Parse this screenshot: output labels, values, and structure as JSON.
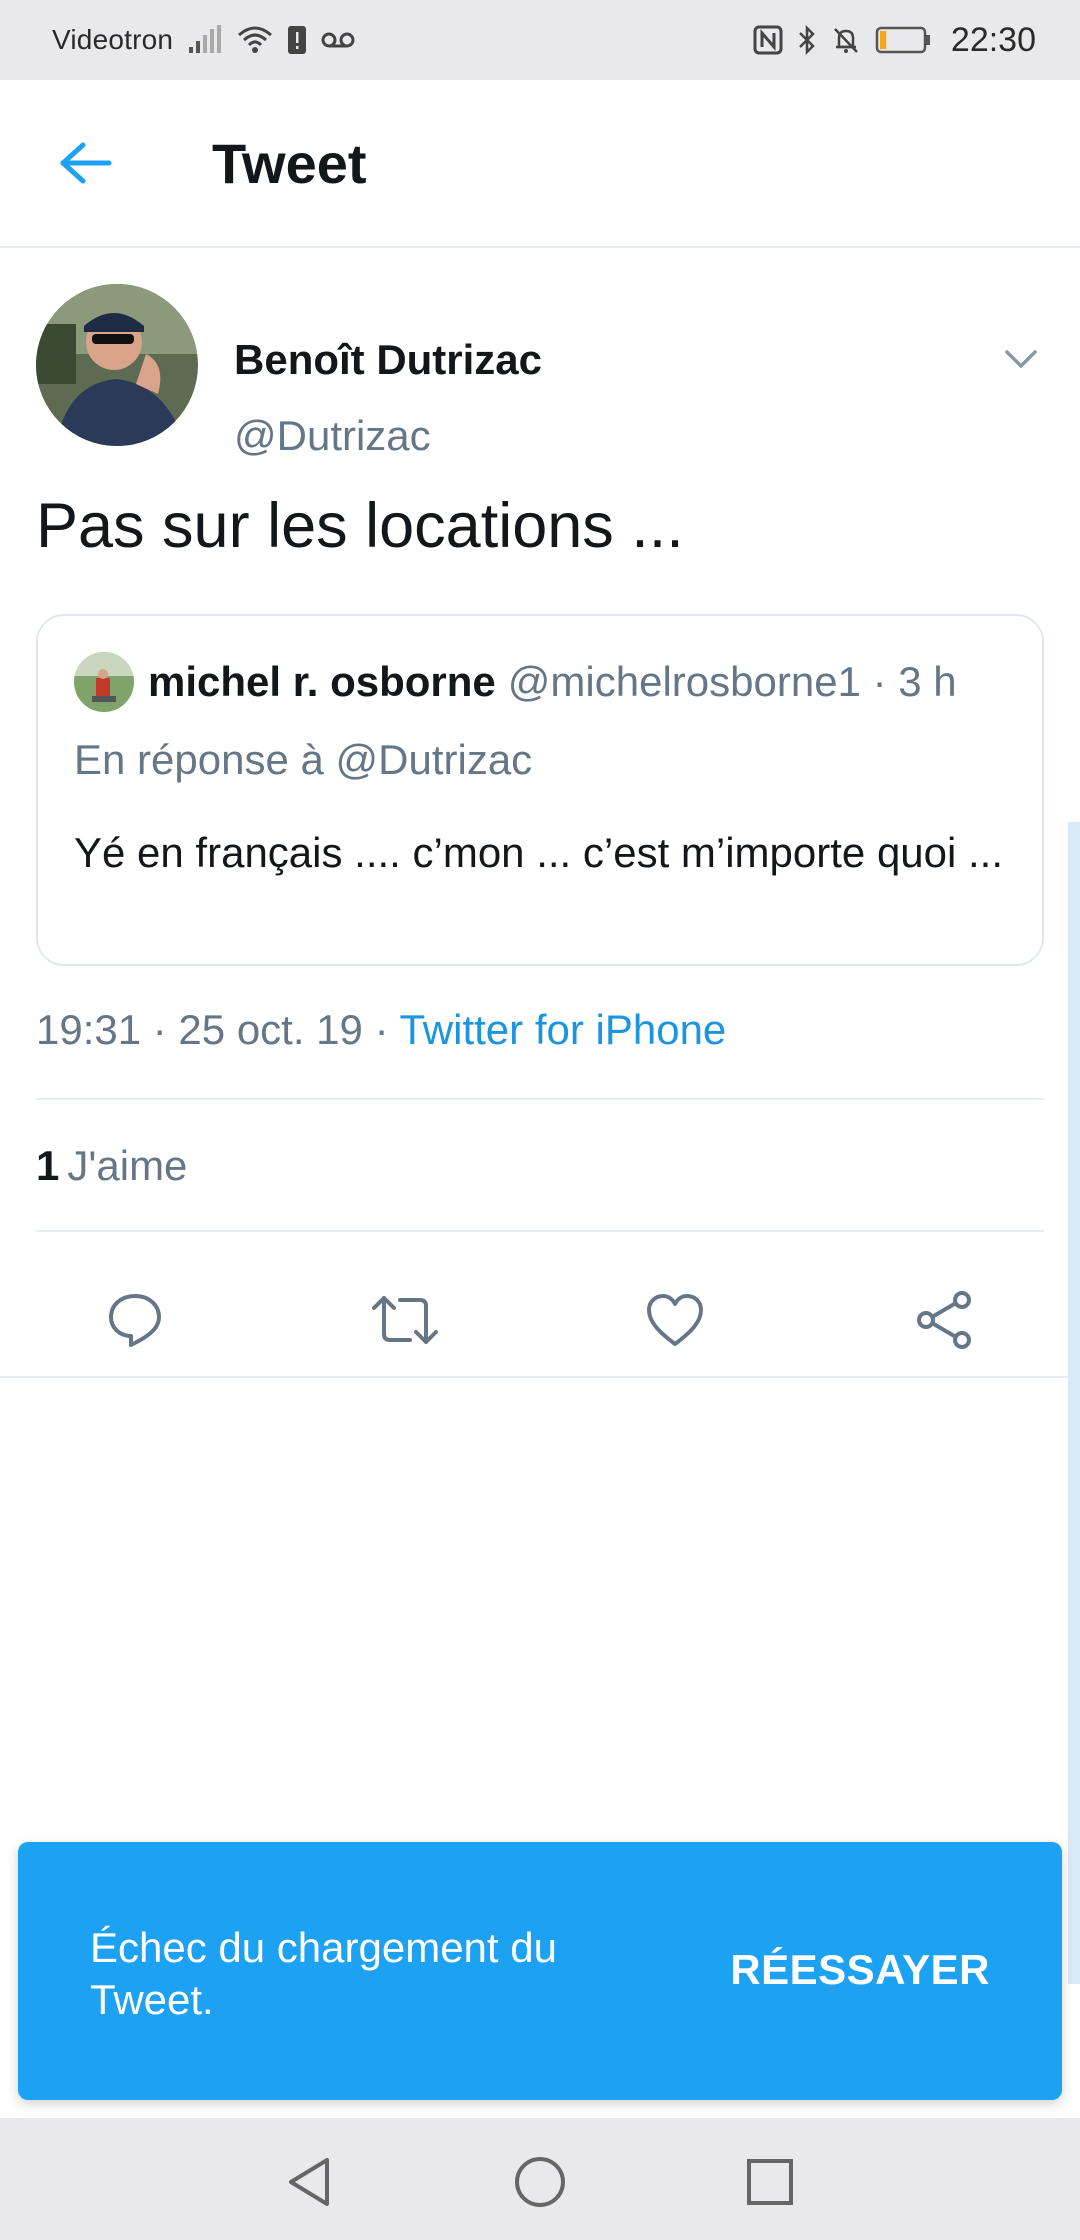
{
  "status_bar": {
    "carrier": "Videotron",
    "time": "22:30",
    "icons": [
      "signal-icon",
      "wifi-icon",
      "sim-alert-icon",
      "voicemail-icon",
      "nfc-icon",
      "bluetooth-icon",
      "mute-icon",
      "battery-icon"
    ],
    "battery_level": 0.15,
    "battery_color": "#f5a623"
  },
  "header": {
    "back_icon": "arrow-left-icon",
    "title": "Tweet",
    "accent": "#1da1f2"
  },
  "tweet": {
    "author_name": "Benoît Dutrizac",
    "author_handle": "@Dutrizac",
    "menu_icon": "chevron-down-icon",
    "text": "Pas sur les locations ...",
    "quoted": {
      "name": "michel r. osborne",
      "handle": "@michelrosborne1 · 3 h",
      "reply_to": "En réponse à @Dutrizac",
      "text": "Yé en français .... c’mon ... c’est m’importe quoi ..."
    },
    "timestamp": "19:31 · 25 oct. 19 · ",
    "source": "Twitter for iPhone",
    "likes_count": "1",
    "likes_label": "J'aime",
    "actions": [
      "reply-icon",
      "retweet-icon",
      "like-icon",
      "share-icon"
    ]
  },
  "snackbar": {
    "message": "Échec du chargement du Tweet.",
    "action": "RÉESSAYER",
    "background": "#1da1f2"
  },
  "nav_bar": {
    "buttons": [
      "back-triangle-icon",
      "home-circle-icon",
      "recents-square-icon"
    ]
  }
}
